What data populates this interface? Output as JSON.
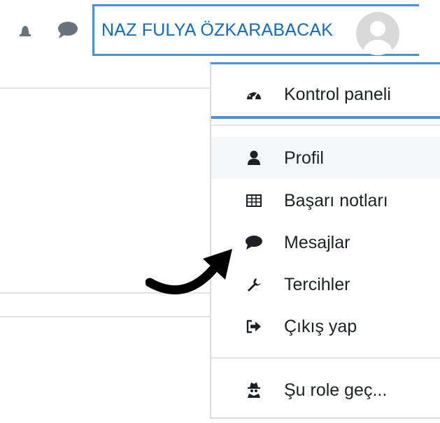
{
  "topbar": {
    "user_name": "NAZ FULYA ÖZKARABACAK"
  },
  "user_menu": {
    "items": [
      {
        "label": "Kontrol paneli",
        "icon": "dashboard-icon"
      },
      {
        "label": "Profil",
        "icon": "user-icon"
      },
      {
        "label": "Başarı notları",
        "icon": "grades-table-icon"
      },
      {
        "label": "Mesajlar",
        "icon": "message-icon"
      },
      {
        "label": "Tercihler",
        "icon": "wrench-icon"
      },
      {
        "label": "Çıkış yap",
        "icon": "sign-out-icon"
      },
      {
        "label": "Şu role geç...",
        "icon": "user-secret-icon"
      }
    ]
  },
  "colors": {
    "accent_border": "#4a90d9",
    "link": "#0f6cbf",
    "text": "#1d2125"
  }
}
